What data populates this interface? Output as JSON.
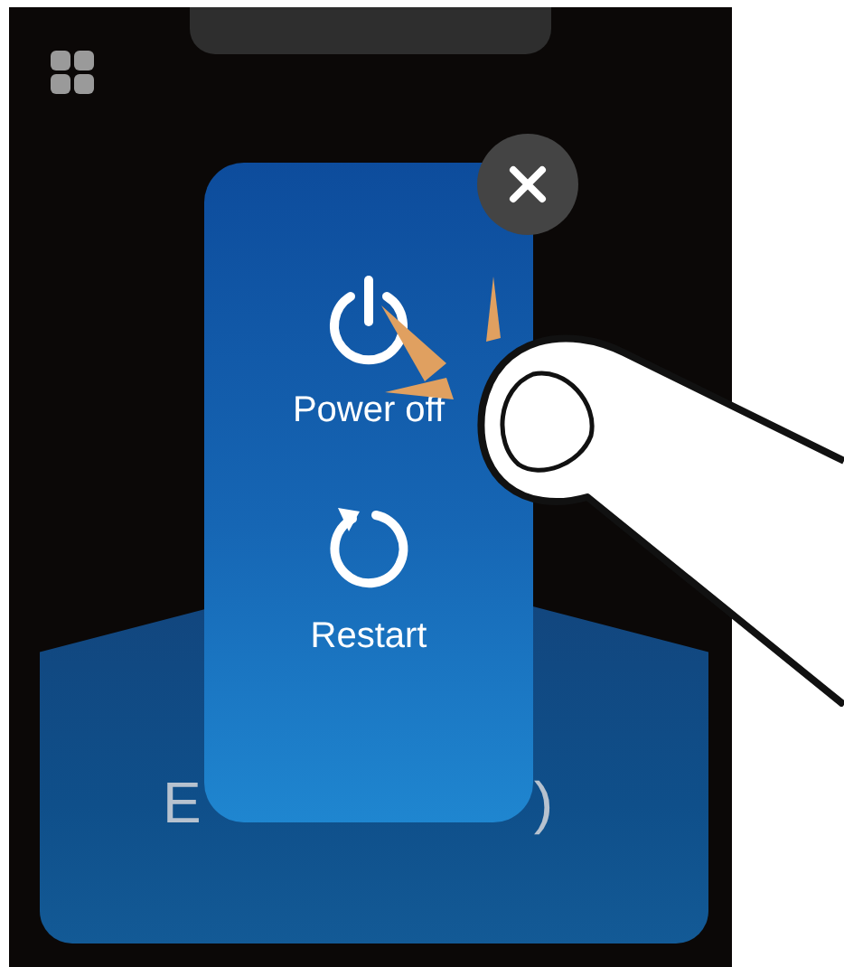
{
  "background_panel": {
    "label_fragments": [
      "E",
      ")"
    ]
  },
  "power_menu": {
    "items": [
      {
        "kind": "power",
        "label": "Power off"
      },
      {
        "kind": "restart",
        "label": "Restart"
      }
    ]
  }
}
